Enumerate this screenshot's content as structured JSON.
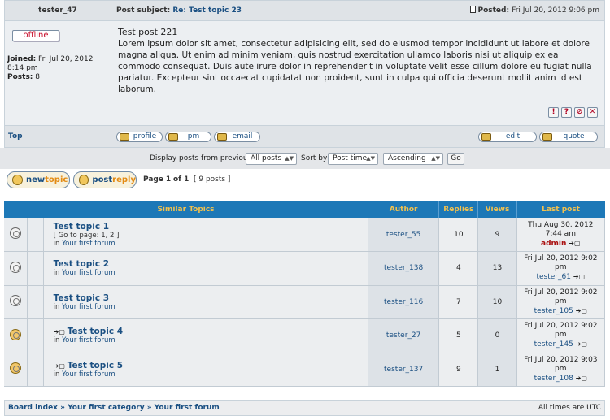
{
  "post": {
    "username": "tester_47",
    "subject_label": "Post subject:",
    "subject_link": "Re: Test topic 23",
    "posted_label": "Posted:",
    "posted_date": "Fri Jul 20, 2012 9:06 pm",
    "status": "offline",
    "joined_label": "Joined:",
    "joined_date": "Fri Jul 20, 2012 8:14 pm",
    "posts_label": "Posts:",
    "posts_count": "8",
    "title": "Test post 221",
    "body": "Lorem ipsum dolor sit amet, consectetur adipisicing elit, sed do eiusmod tempor incididunt ut labore et dolore magna aliqua. Ut enim ad minim veniam, quis nostrud exercitation ullamco laboris nisi ut aliquip ex ea commodo consequat. Duis aute irure dolor in reprehenderit in voluptate velit esse cillum dolore eu fugiat nulla pariatur. Excepteur sint occaecat cupidatat non proident, sunt in culpa qui officia deserunt mollit anim id est laborum.",
    "icons": [
      "!",
      "?",
      "⊘",
      "✕"
    ],
    "top_link": "Top",
    "buttons": {
      "profile": "profile",
      "pm": "pm",
      "email": "email",
      "edit": "edit",
      "quote": "quote"
    }
  },
  "display": {
    "label": "Display posts from previous:",
    "days_value": "All posts",
    "sort_label": "Sort by",
    "sort_value": "Post time",
    "order_value": "Ascending",
    "go": "Go"
  },
  "actions": {
    "new_a": "new",
    "new_b": "topic",
    "reply_a": "post",
    "reply_b": "reply",
    "page_label": "Page",
    "page_current": "1",
    "page_of": "of",
    "page_total": "1",
    "posts_info": "[ 9 posts ]"
  },
  "similar": {
    "headers": [
      "Similar Topics",
      "Author",
      "Replies",
      "Views",
      "Last post"
    ],
    "rows": [
      {
        "title": "Test topic 1",
        "goto": "[ Go to page: 1, 2 ]",
        "forum_prefix": "in",
        "forum": "Your first forum",
        "author": "tester_55",
        "replies": "10",
        "views": "9",
        "last_date": "Thu Aug 30, 2012",
        "last_time": "7:44 am",
        "last_user": "admin",
        "moved": false,
        "admin": true
      },
      {
        "title": "Test topic 2",
        "goto": "",
        "forum_prefix": "in",
        "forum": "Your first forum",
        "author": "tester_138",
        "replies": "4",
        "views": "13",
        "last_date": "Fri Jul 20, 2012 9:02",
        "last_time": "pm",
        "last_user": "tester_61",
        "moved": false,
        "admin": false
      },
      {
        "title": "Test topic 3",
        "goto": "",
        "forum_prefix": "in",
        "forum": "Your first forum",
        "author": "tester_116",
        "replies": "7",
        "views": "10",
        "last_date": "Fri Jul 20, 2012 9:02",
        "last_time": "pm",
        "last_user": "tester_105",
        "moved": false,
        "admin": false
      },
      {
        "title": "Test topic 4",
        "goto": "",
        "forum_prefix": "in",
        "forum": "Your first forum",
        "author": "tester_27",
        "replies": "5",
        "views": "0",
        "last_date": "Fri Jul 20, 2012 9:02",
        "last_time": "pm",
        "last_user": "tester_145",
        "moved": true,
        "admin": false
      },
      {
        "title": "Test topic 5",
        "goto": "",
        "forum_prefix": "in",
        "forum": "Your first forum",
        "author": "tester_137",
        "replies": "9",
        "views": "1",
        "last_date": "Fri Jul 20, 2012 9:03",
        "last_time": "pm",
        "last_user": "tester_108",
        "moved": true,
        "admin": false
      }
    ]
  },
  "footer": {
    "board_index": "Board index",
    "category": "Your first category",
    "forum": "Your first forum",
    "timezone": "All times are UTC"
  }
}
